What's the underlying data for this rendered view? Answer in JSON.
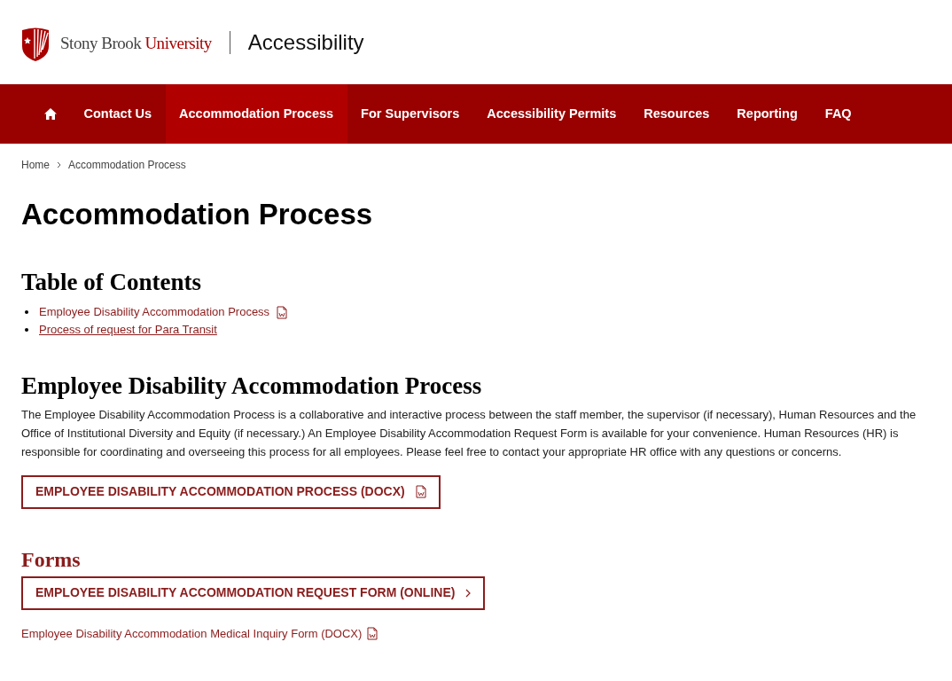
{
  "header": {
    "brand": "Stony Brook",
    "brand_accent": "University",
    "site_title": "Accessibility"
  },
  "nav": [
    {
      "kind": "home",
      "selected": false
    },
    {
      "label": "Contact Us",
      "selected": false
    },
    {
      "label": "Accommodation Process",
      "selected": true
    },
    {
      "label": "For Supervisors",
      "selected": false
    },
    {
      "label": "Accessibility Permits",
      "selected": false
    },
    {
      "label": "Resources",
      "selected": false
    },
    {
      "label": "Reporting",
      "selected": false
    },
    {
      "label": "FAQ",
      "selected": false
    }
  ],
  "breadcrumb": [
    "Home",
    "Accommodation Process"
  ],
  "page_title": "Accommodation Process",
  "toc": {
    "heading": "Table of Contents",
    "items": [
      {
        "label": "Employee Disability Accommodation Process",
        "kind": "document"
      },
      {
        "label": "Process of request for Para Transit",
        "kind": "link"
      }
    ]
  },
  "section": {
    "heading": "Employee Disability Accommodation Process",
    "text": "The Employee Disability Accommodation Process is a collaborative and interactive process between the staff member, the supervisor (if necessary), Human Resources and the Office of Institutional Diversity and Equity (if necessary.) An Employee Disability Accommodation Request Form is available for your convenience. Human Resources (HR) is responsible for coordinating and overseeing this process for all employees. Please feel free to contact your appropriate HR office with any questions or concerns.",
    "button": {
      "label": "EMPLOYEE DISABILITY ACCOMMODATION PROCESS (DOCX)",
      "kind": "document"
    }
  },
  "forms": {
    "heading": "Forms",
    "items": [
      {
        "label": "EMPLOYEE DISABILITY ACCOMMODATION REQUEST FORM (ONLINE)",
        "kind": "online"
      },
      {
        "label": "Employee Disability Accommodation Medical Inquiry Form (DOCX)",
        "kind": "document-link"
      }
    ]
  }
}
